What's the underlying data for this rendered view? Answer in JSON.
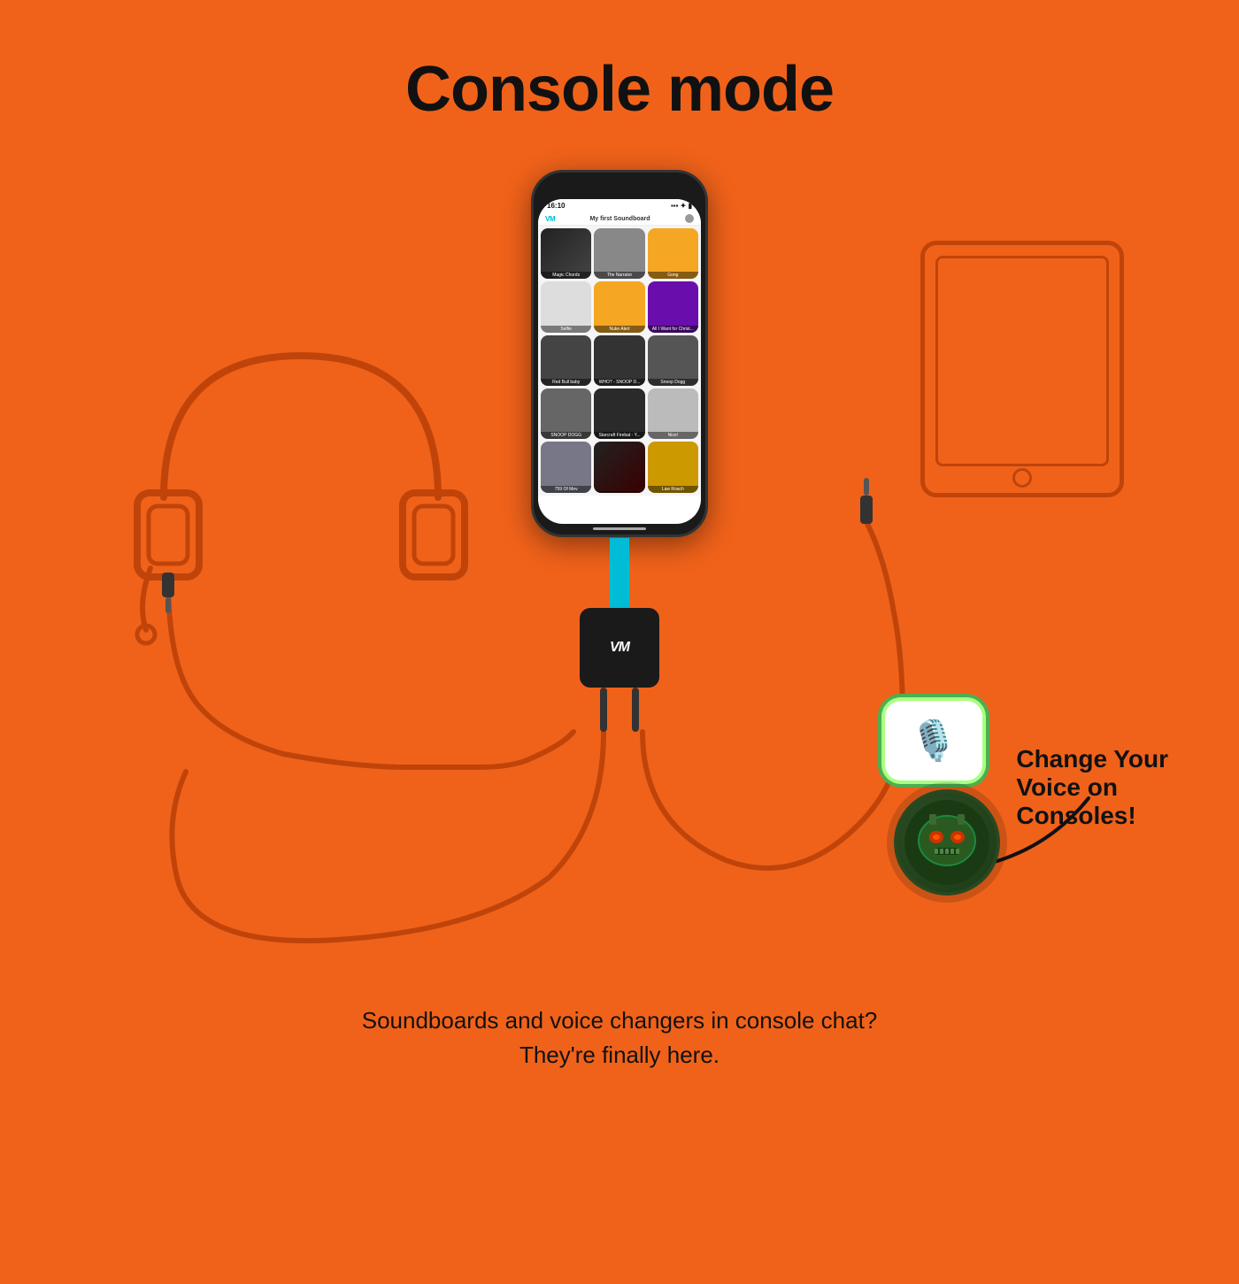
{
  "page": {
    "title": "Console mode",
    "background_color": "#F0621A"
  },
  "phone": {
    "time": "16:10",
    "app_name": "My first Soundboard",
    "grid_items": [
      {
        "label": "Magic Chords",
        "color": "cell-music"
      },
      {
        "label": "The Narrator",
        "color": "cell-face"
      },
      {
        "label": "Gong",
        "color": "cell-yellow"
      },
      {
        "label": "Selfie",
        "color": "cell-cam"
      },
      {
        "label": "Nuke Alert",
        "color": "cell-nuke"
      },
      {
        "label": "All I Want for Christ...",
        "color": "cell-purple"
      },
      {
        "label": "Red Bull baby",
        "color": "cell-redbull"
      },
      {
        "label": "WHO? - SNOOP D...",
        "color": "cell-who"
      },
      {
        "label": "Snoop Dogg",
        "color": "cell-snoop"
      },
      {
        "label": "SNOOP DOGG",
        "color": "cell-snoop2"
      },
      {
        "label": "Starcraft Firebat - Y...",
        "color": "cell-star"
      },
      {
        "label": "Nice!",
        "color": "cell-nice"
      },
      {
        "label": "759 Of Mev",
        "color": "cell-row4a"
      },
      {
        "label": "",
        "color": "cell-row4b"
      },
      {
        "label": "Law Roach",
        "color": "cell-row4c"
      }
    ]
  },
  "cta": {
    "line1": "Change Your",
    "line2": "Voice on",
    "line3": "Consoles!"
  },
  "bottom": {
    "line1": "Soundboards and voice changers in console chat?",
    "line2": "They're finally here."
  },
  "mic_bubble_icon": "🎙️",
  "robot_icon": "🤖"
}
